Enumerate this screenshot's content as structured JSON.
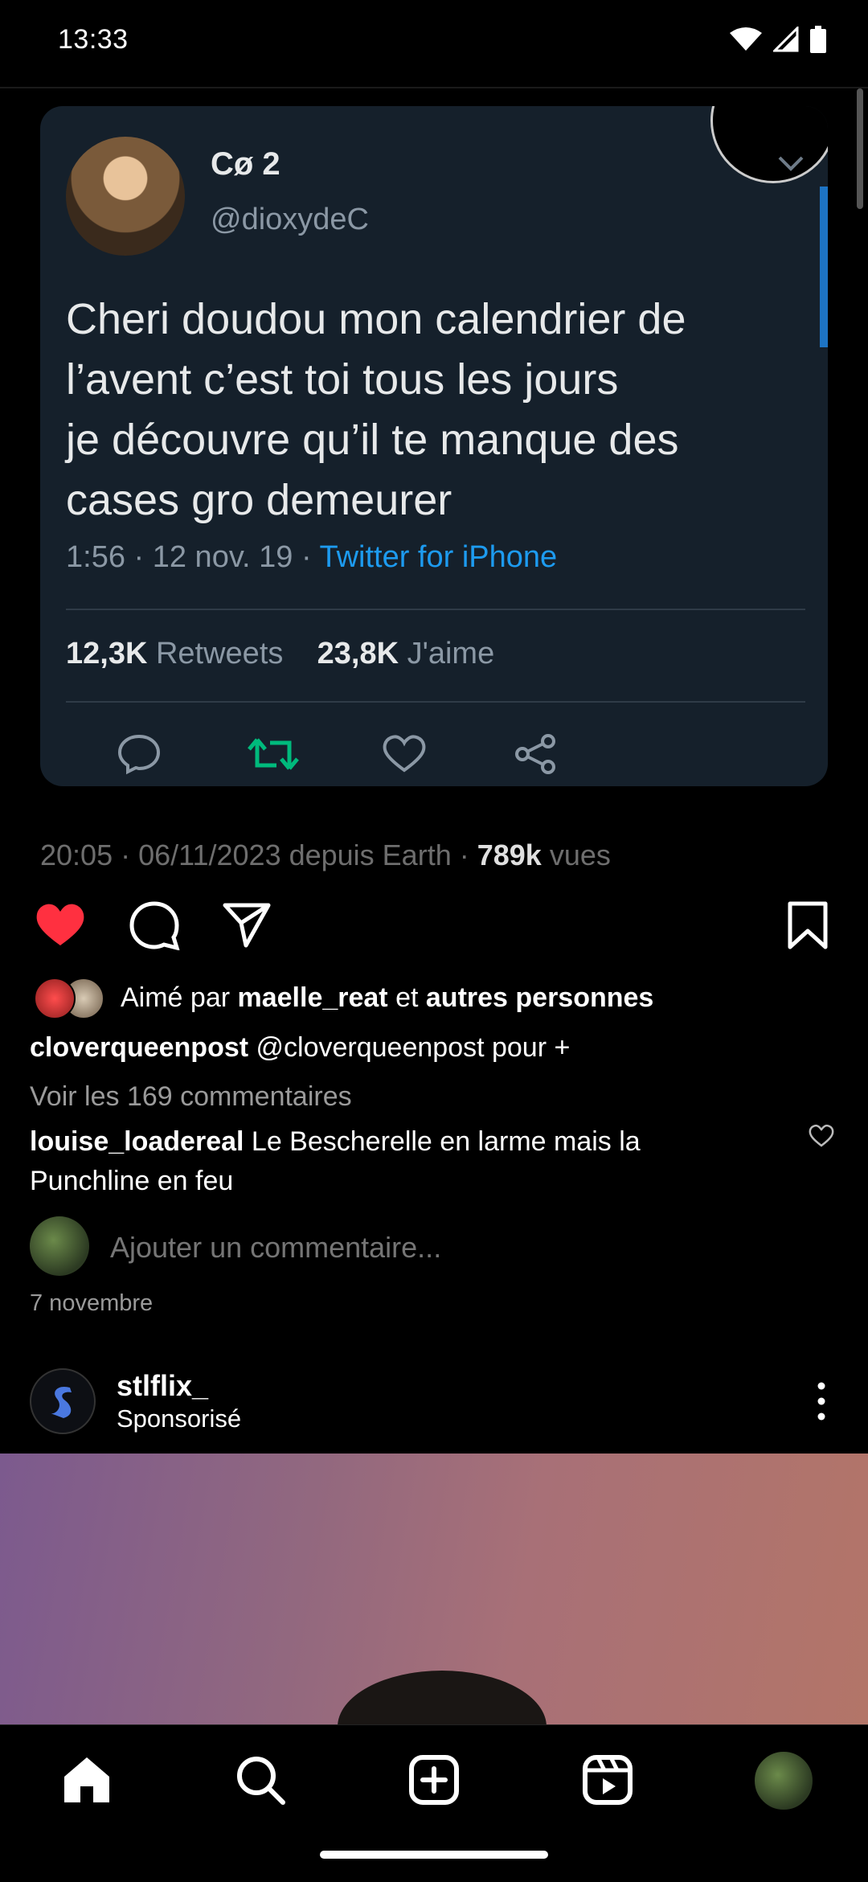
{
  "status_bar": {
    "time": "13:33"
  },
  "tweet": {
    "name": "Cø 2",
    "handle": "@dioxydeC",
    "text": "Cheri doudou mon calendrier de\nl’avent c’est toi  tous les jours\nje découvre qu’il te manque des\ncases  gro demeurer",
    "time_date": "1:56 · 12 nov. 19 · ",
    "client": "Twitter for iPhone",
    "retweets_count": "12,3K",
    "retweets_label": "Retweets",
    "likes_count": "23,8K",
    "likes_label": "J'aime"
  },
  "post_meta": {
    "prefix": "20:05 · 06/11/2023 depuis Earth · ",
    "views_count": "789k",
    "views_label": " vues"
  },
  "likes": {
    "prefix": "Aimé par ",
    "user": "maelle_reat",
    "middle": " et ",
    "others": "autres personnes"
  },
  "caption": {
    "username": "cloverqueenpost",
    "text": " @cloverqueenpost pour +"
  },
  "view_comments": "Voir les 169 commentaires",
  "comment": {
    "username": "louise_loadereal",
    "text": " Le Bescherelle en larme mais la Punchline en feu"
  },
  "add_comment_placeholder": "Ajouter un commentaire...",
  "post_date": "7 novembre",
  "sponsored": {
    "username": "stlflix_",
    "label": "Sponsorisé"
  },
  "colors": {
    "like_red": "#ff3040",
    "retweet_green": "#00ba7c",
    "twitter_blue": "#1d9bf0",
    "tweet_bg": "#15202b"
  },
  "icons": [
    "heart-icon",
    "comment-icon",
    "share-icon",
    "bookmark-icon",
    "home-icon",
    "search-icon",
    "create-icon",
    "reels-icon",
    "profile-icon",
    "more-icon"
  ]
}
